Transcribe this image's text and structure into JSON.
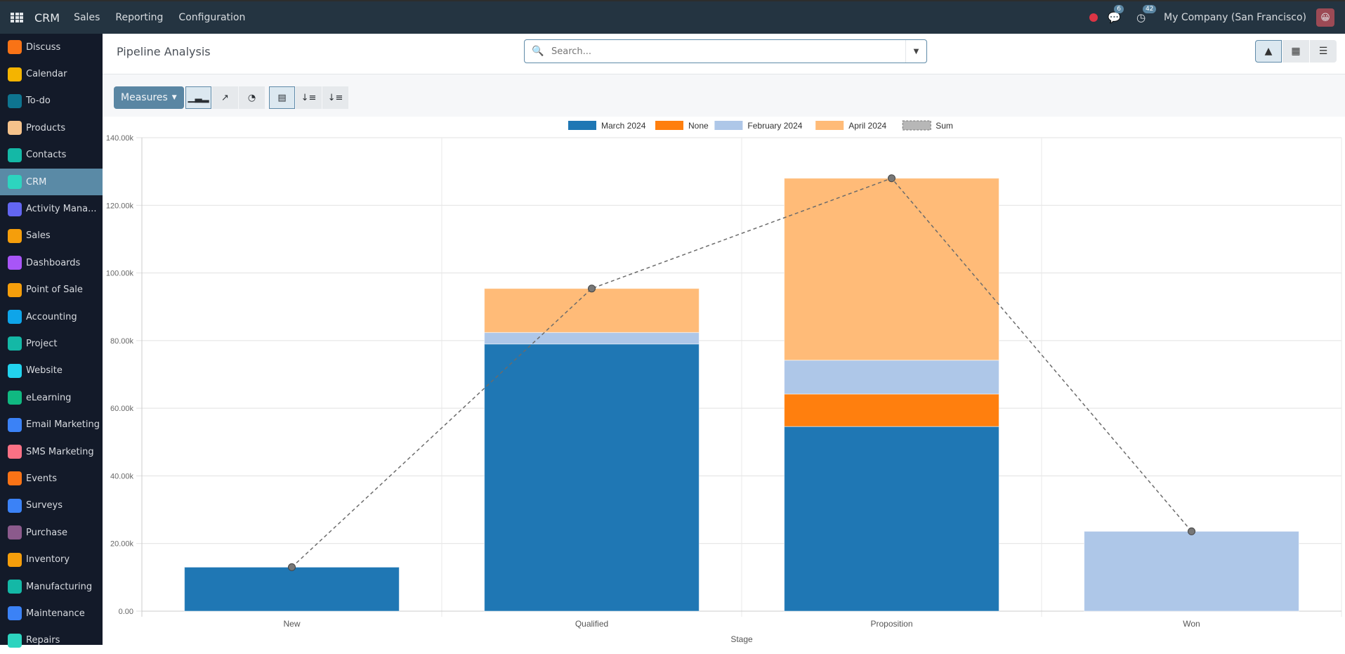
{
  "topbar": {
    "brand": "CRM",
    "nav": [
      "Sales",
      "Reporting",
      "Configuration"
    ],
    "messages_count": "6",
    "activities_count": "42",
    "company": "My Company (San Francisco)"
  },
  "sidebar": {
    "items": [
      {
        "label": "Discuss",
        "color": "#f97316"
      },
      {
        "label": "Calendar",
        "color": "#f4b400"
      },
      {
        "label": "To-do",
        "color": "#0e7490"
      },
      {
        "label": "Products",
        "color": "#f5c28b"
      },
      {
        "label": "Contacts",
        "color": "#14b8a6"
      },
      {
        "label": "CRM",
        "color": "#2dd4bf",
        "active": true
      },
      {
        "label": "Activity Mana...",
        "color": "#6366f1"
      },
      {
        "label": "Sales",
        "color": "#f59e0b"
      },
      {
        "label": "Dashboards",
        "color": "#a855f7"
      },
      {
        "label": "Point of Sale",
        "color": "#f59e0b"
      },
      {
        "label": "Accounting",
        "color": "#0ea5e9"
      },
      {
        "label": "Project",
        "color": "#14b8a6"
      },
      {
        "label": "Website",
        "color": "#22d3ee"
      },
      {
        "label": "eLearning",
        "color": "#10b981"
      },
      {
        "label": "Email Marketing",
        "color": "#3b82f6"
      },
      {
        "label": "SMS Marketing",
        "color": "#fb7185"
      },
      {
        "label": "Events",
        "color": "#f97316"
      },
      {
        "label": "Surveys",
        "color": "#3b82f6"
      },
      {
        "label": "Purchase",
        "color": "#8b5a8c"
      },
      {
        "label": "Inventory",
        "color": "#f59e0b"
      },
      {
        "label": "Manufacturing",
        "color": "#14b8a6"
      },
      {
        "label": "Maintenance",
        "color": "#3b82f6"
      },
      {
        "label": "Repairs",
        "color": "#2dd4bf"
      }
    ]
  },
  "control": {
    "title": "Pipeline Analysis",
    "search_placeholder": "Search..."
  },
  "toolbar": {
    "measures_label": "Measures"
  },
  "chart_data": {
    "type": "bar",
    "stacked": true,
    "title": "",
    "xlabel": "Stage",
    "ylabel": "",
    "categories": [
      "New",
      "Qualified",
      "Proposition",
      "Won"
    ],
    "ylim": [
      0,
      140000
    ],
    "yticks": [
      "0.00",
      "20.00k",
      "40.00k",
      "60.00k",
      "80.00k",
      "100.00k",
      "120.00k",
      "140.00k"
    ],
    "ytick_values": [
      0,
      20000,
      40000,
      60000,
      80000,
      100000,
      120000,
      140000
    ],
    "grid": true,
    "legend_position": "top-center",
    "series": [
      {
        "name": "March 2024",
        "color": "#1f77b4",
        "values": [
          13000,
          79000,
          54600,
          0
        ]
      },
      {
        "name": "None",
        "color": "#ff7f0e",
        "values": [
          0,
          0,
          9600,
          0
        ]
      },
      {
        "name": "February 2024",
        "color": "#aec7e8",
        "values": [
          0,
          3400,
          10000,
          23600
        ]
      },
      {
        "name": "April 2024",
        "color": "#ffbb78",
        "values": [
          0,
          13000,
          53800,
          0
        ]
      }
    ],
    "line_series": {
      "name": "Sum",
      "color": "#6b6b6b",
      "style": "dashed",
      "values": [
        13000,
        95400,
        128000,
        23600
      ]
    }
  }
}
